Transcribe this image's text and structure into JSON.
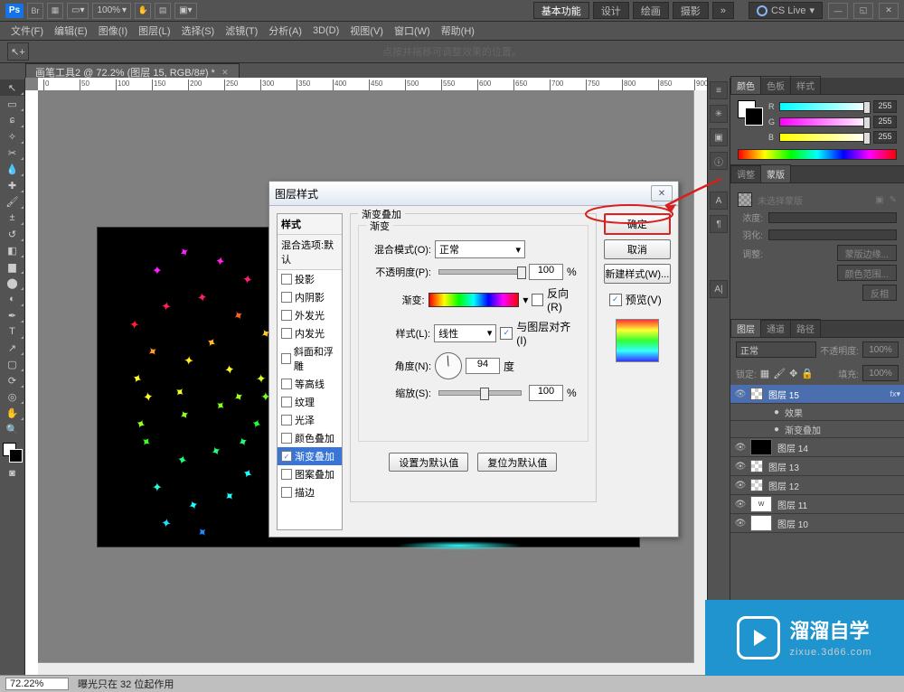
{
  "top": {
    "ps": "Ps",
    "zoom": "100%",
    "functions": "基本功能",
    "design": "设计",
    "paint": "绘画",
    "photo": "摄影",
    "cslive": "CS Live"
  },
  "menu": [
    "文件(F)",
    "编辑(E)",
    "图像(I)",
    "图层(L)",
    "选择(S)",
    "滤镜(T)",
    "分析(A)",
    "3D(D)",
    "视图(V)",
    "窗口(W)",
    "帮助(H)"
  ],
  "optbar": {
    "hint": "点按并拖移可调整效果的位置。"
  },
  "doc": {
    "tab": "画笔工具2 @ 72.2% (图层 15, RGB/8#) *"
  },
  "colorPanel": {
    "tabs": [
      "颜色",
      "色板",
      "样式"
    ],
    "r": "255",
    "g": "255",
    "b": "255"
  },
  "adjPanel": {
    "tabs": [
      "调整",
      "蒙版"
    ],
    "empty": "未选择蒙版",
    "density": "浓度:",
    "feather": "羽化:",
    "subhead": "调整:",
    "btn1": "蒙版边缘...",
    "btn2": "颜色范围...",
    "btn3": "反相"
  },
  "layersPanel": {
    "tabs": [
      "图层",
      "通道",
      "路径"
    ],
    "blend": "正常",
    "opacityLbl": "不透明度:",
    "opacity": "100%",
    "lockLbl": "锁定:",
    "fillLbl": "填充:",
    "fill": "100%",
    "layers": [
      {
        "name": "图层 15",
        "sel": true,
        "thumb": "chk"
      },
      {
        "name": "效果",
        "sub": true
      },
      {
        "name": "渐变叠加",
        "sub": true
      },
      {
        "name": "图层 14",
        "thumb": "black"
      },
      {
        "name": "图层 13",
        "thumb": "chk"
      },
      {
        "name": "图层 12",
        "thumb": "chk"
      },
      {
        "name": "图层 11",
        "thumb": "txt"
      },
      {
        "name": "图层 10",
        "thumb": "white"
      }
    ]
  },
  "dialog": {
    "title": "图层样式",
    "listHead": "样式",
    "listDefaults": "混合选项:默认",
    "list": [
      "投影",
      "内阴影",
      "外发光",
      "内发光",
      "斜面和浮雕",
      "等高线",
      "纹理",
      "光泽",
      "颜色叠加",
      "渐变叠加",
      "图案叠加",
      "描边"
    ],
    "selected": "渐变叠加",
    "group": "渐变叠加",
    "subgroup": "渐变",
    "blendLbl": "混合模式(O):",
    "blendVal": "正常",
    "opacLbl": "不透明度(P):",
    "opacVal": "100",
    "pct": "%",
    "gradLbl": "渐变:",
    "reverse": "反向(R)",
    "styleLbl": "样式(L):",
    "styleVal": "线性",
    "align": "与图层对齐(I)",
    "angleLbl": "角度(N):",
    "angleVal": "94",
    "deg": "度",
    "scaleLbl": "缩放(S):",
    "scaleVal": "100",
    "setDefault": "设置为默认值",
    "resetDefault": "复位为默认值",
    "ok": "确定",
    "cancel": "取消",
    "newStyle": "新建样式(W)...",
    "preview": "预览(V)"
  },
  "status": {
    "zoom": "72.22%",
    "text": "曝光只在 32 位起作用"
  },
  "wm": {
    "title": "溜溜自学",
    "sub": "zixue.3d66.com"
  }
}
